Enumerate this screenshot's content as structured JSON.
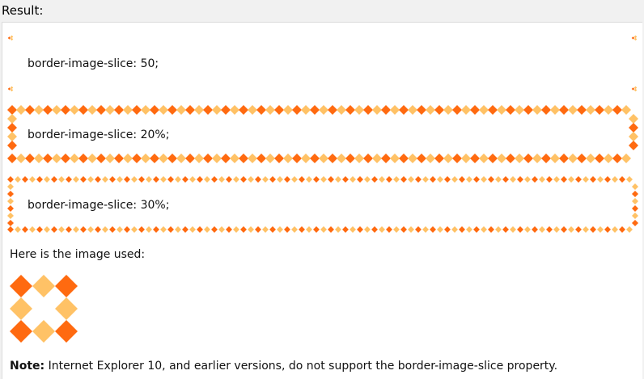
{
  "header": {
    "result_label": "Result:"
  },
  "demos": [
    {
      "text": "border-image-slice: 50;"
    },
    {
      "text": "border-image-slice: 20%;"
    },
    {
      "text": "border-image-slice: 30%;"
    }
  ],
  "caption": "Here is the image used:",
  "note": {
    "label": "Note:",
    "text": " Internet Explorer 10, and earlier versions, do not support the border-image-slice property."
  },
  "colors": {
    "dark_orange": "#ff6a10",
    "light_orange": "#ffc266",
    "page_bg": "#f1f1f1",
    "frame_bg": "#ffffff"
  },
  "icons": [
    "diamond-corner-icon",
    "diamond-pattern-image"
  ]
}
